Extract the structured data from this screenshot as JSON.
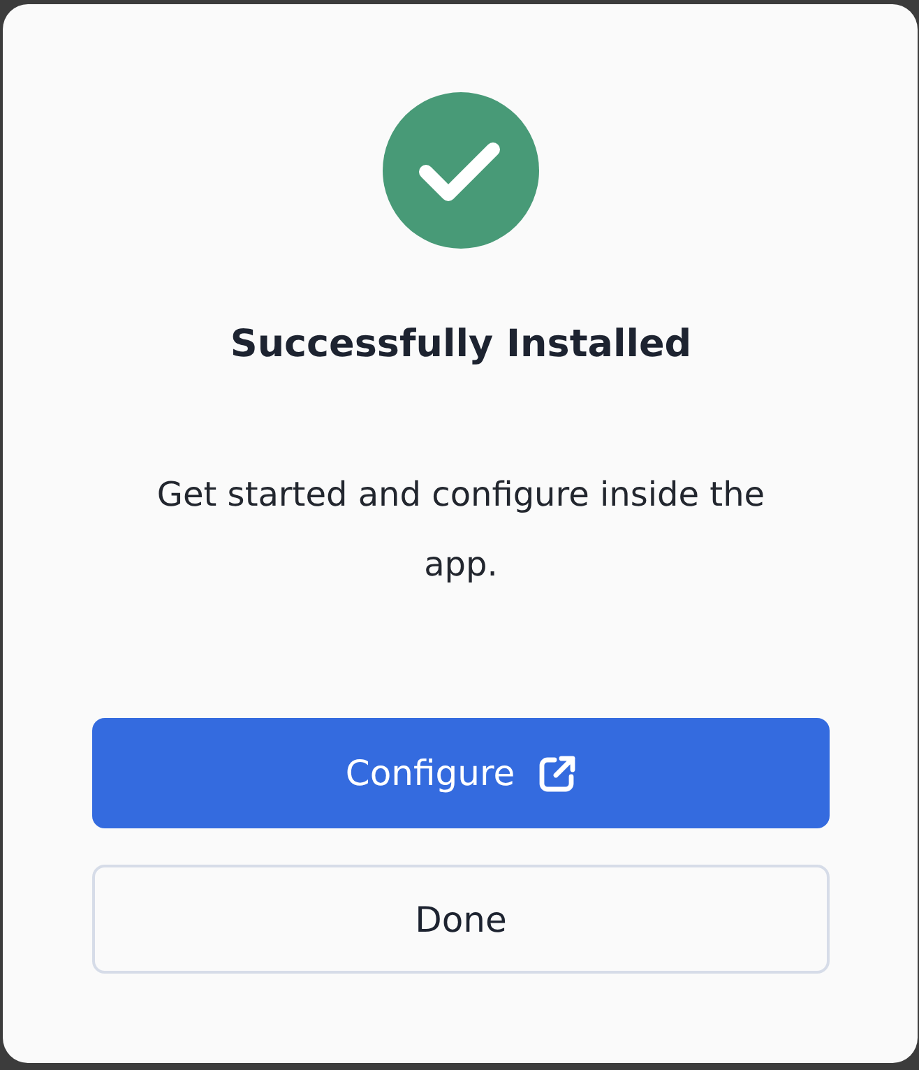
{
  "dialog": {
    "success": true,
    "title": "Successfully Installed",
    "message": "Get started and configure inside the app.",
    "buttons": [
      {
        "label": "Configure",
        "kind": "primary",
        "external": true
      },
      {
        "label": "Done",
        "kind": "secondary",
        "external": false
      }
    ]
  }
}
